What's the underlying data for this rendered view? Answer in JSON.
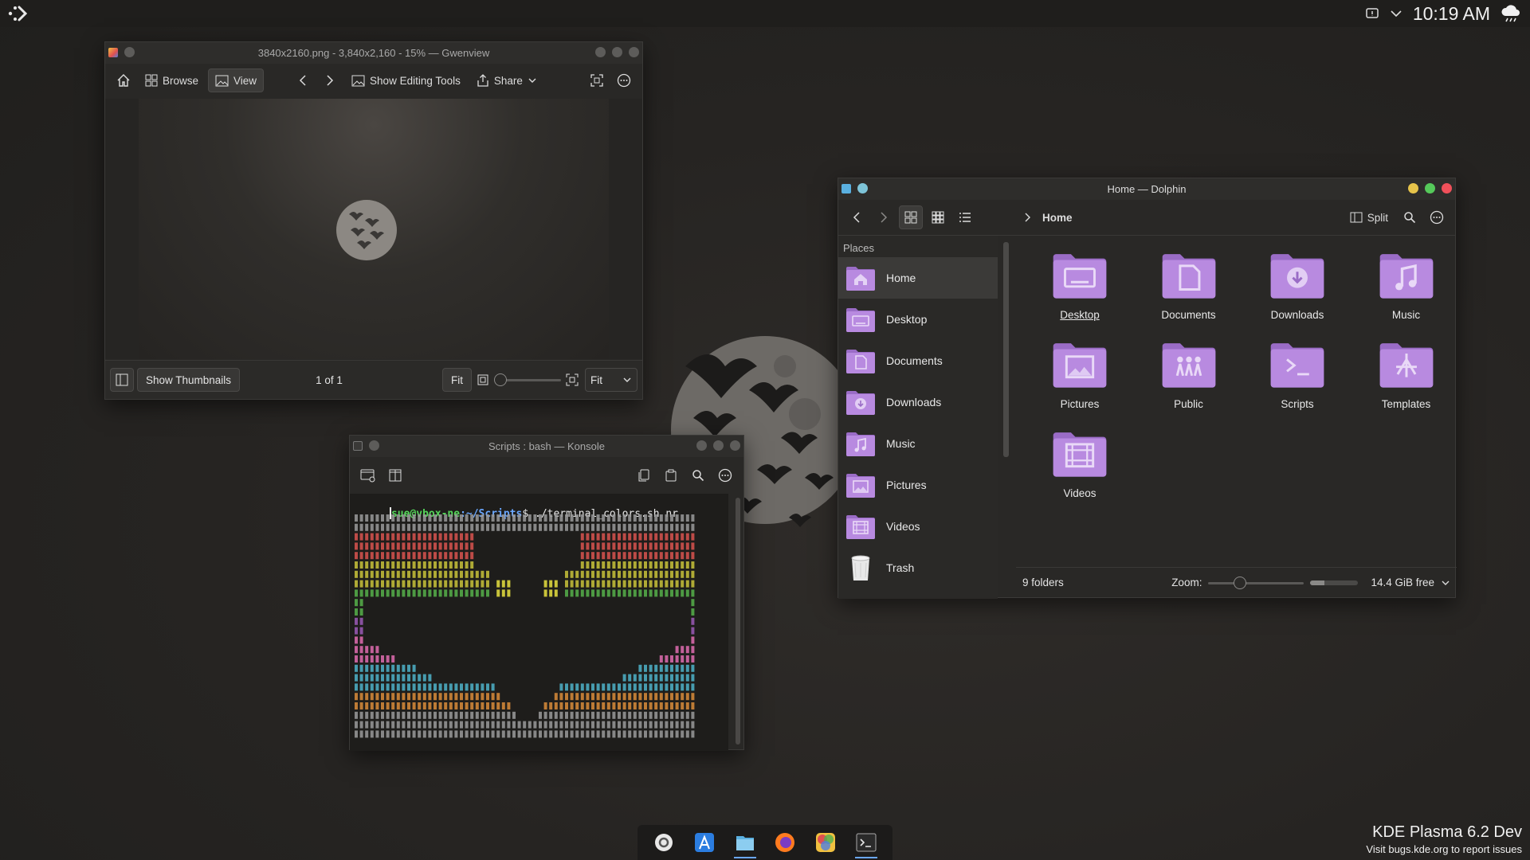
{
  "top_panel": {
    "launcher_icon": "kde-launcher-icon",
    "clock": "10:19 AM",
    "tray_icons": [
      "notifications-icon",
      "chevron-down-icon",
      "weather-icon"
    ]
  },
  "gwenview": {
    "title": "3840x2160.png - 3,840x2,160 - 15% — Gwenview",
    "toolbar": {
      "browse": "Browse",
      "view": "View",
      "show_editing_tools": "Show Editing Tools",
      "share": "Share"
    },
    "bottom": {
      "show_thumbnails": "Show Thumbnails",
      "page_counter": "1 of 1",
      "fit_button": "Fit",
      "zoom_select": "Fit"
    }
  },
  "konsole": {
    "title": "Scripts : bash — Konsole",
    "prompt_user": "sue@vbox-ne",
    "prompt_path": ":~/Scripts",
    "prompt_symbol": "$",
    "command": " ./terminal_colors.sh nr",
    "art_colors": [
      "#d9534f",
      "#e0a030",
      "#c9c33a",
      "#56b04a",
      "#9b59b6",
      "#e06cb0",
      "#4fb3c9",
      "#d98c3a",
      "#9a9a9a"
    ]
  },
  "dolphin": {
    "title": "Home — Dolphin",
    "breadcrumb": "Home",
    "split_label": "Split",
    "places_header": "Places",
    "places": [
      {
        "label": "Home",
        "icon": "home-folder-icon",
        "selected": true
      },
      {
        "label": "Desktop",
        "icon": "desktop-folder-icon"
      },
      {
        "label": "Documents",
        "icon": "documents-folder-icon"
      },
      {
        "label": "Downloads",
        "icon": "downloads-folder-icon"
      },
      {
        "label": "Music",
        "icon": "music-folder-icon"
      },
      {
        "label": "Pictures",
        "icon": "pictures-folder-icon"
      },
      {
        "label": "Videos",
        "icon": "videos-folder-icon"
      },
      {
        "label": "Trash",
        "icon": "trash-icon"
      }
    ],
    "folders": [
      {
        "label": "Desktop",
        "icon": "desktop-folder-icon"
      },
      {
        "label": "Documents",
        "icon": "documents-folder-icon"
      },
      {
        "label": "Downloads",
        "icon": "downloads-folder-icon"
      },
      {
        "label": "Music",
        "icon": "music-folder-icon"
      },
      {
        "label": "Pictures",
        "icon": "pictures-folder-icon"
      },
      {
        "label": "Public",
        "icon": "public-folder-icon"
      },
      {
        "label": "Scripts",
        "icon": "scripts-folder-icon"
      },
      {
        "label": "Templates",
        "icon": "templates-folder-icon"
      },
      {
        "label": "Videos",
        "icon": "videos-folder-icon"
      }
    ],
    "status": {
      "count": "9 folders",
      "zoom_label": "Zoom:",
      "free_space": "14.4 GiB free"
    },
    "colors": {
      "folder": "#b88ae0",
      "folder_dark": "#9a6cc6",
      "close": "#f0505a",
      "minimize": "#e6c34a",
      "maximize": "#55c95a"
    }
  },
  "dock": {
    "items": [
      {
        "name": "system-settings-icon"
      },
      {
        "name": "discover-icon"
      },
      {
        "name": "dolphin-icon",
        "running": true
      },
      {
        "name": "firefox-icon"
      },
      {
        "name": "gwenview-icon"
      },
      {
        "name": "konsole-icon",
        "running": true
      }
    ]
  },
  "watermark": {
    "title": "KDE Plasma 6.2 Dev",
    "subtitle": "Visit bugs.kde.org to report issues"
  }
}
